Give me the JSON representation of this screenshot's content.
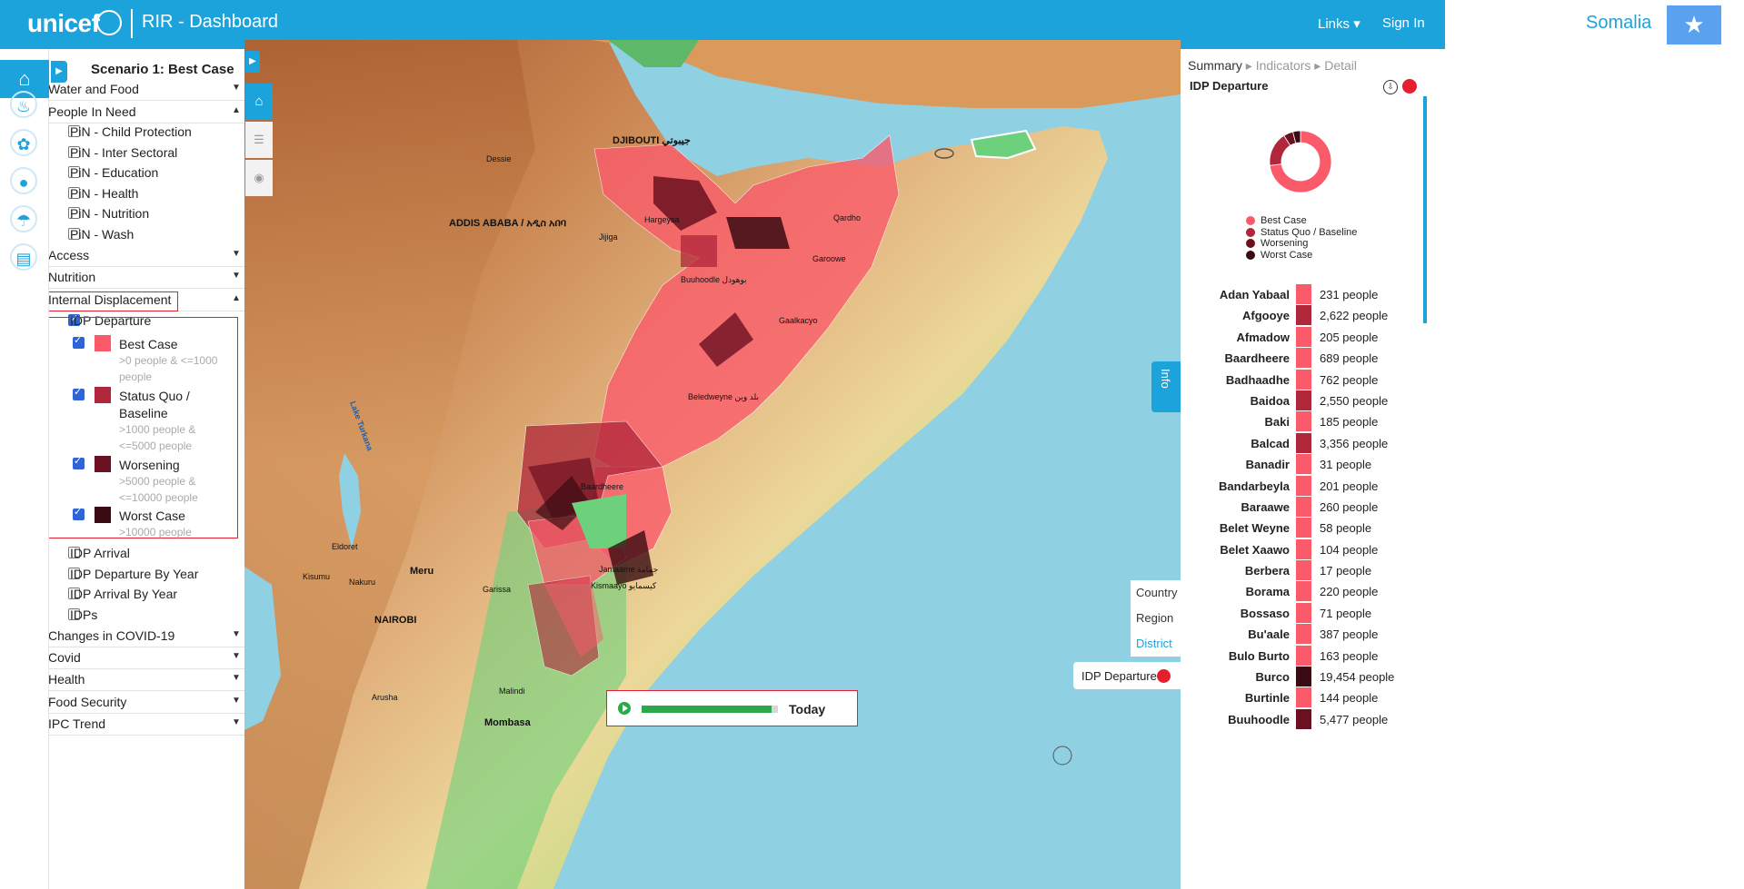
{
  "header": {
    "brand": "unicef",
    "app_title": "RIR - Dashboard",
    "links_label": "Links",
    "sign_in_label": "Sign In",
    "country": "Somalia",
    "brand_color": "#1ca3dc"
  },
  "panel": {
    "scenario": "Scenario 1: Best Case",
    "rows": [
      {
        "label": "Water and Food",
        "caret": "down",
        "dot": "#e5c400",
        "dot_inner": true
      },
      {
        "label": "People In Need",
        "caret": "up",
        "dot": "#e5c400"
      },
      {
        "label": "PiN - Child Protection",
        "checkbox": true,
        "dot": "#e5c400"
      },
      {
        "label": "PiN - Inter Sectoral",
        "checkbox": true,
        "dot": "#e5c400"
      },
      {
        "label": "PiN - Education",
        "checkbox": true,
        "dot": "#e5c400"
      },
      {
        "label": "PiN - Health",
        "checkbox": true,
        "dot": "#e4202e"
      },
      {
        "label": "PiN - Nutrition",
        "checkbox": true,
        "dot": "#e4202e"
      },
      {
        "label": "PiN - Wash",
        "checkbox": true,
        "dot": "#e5c400"
      },
      {
        "label": "Access",
        "caret": "down",
        "dot": "#4a8af4"
      },
      {
        "label": "Nutrition",
        "caret": "down",
        "dot": "#dddddd",
        "dot_inner": true
      },
      {
        "label": "Internal Displacement",
        "caret": "up",
        "dot": "#e4202e"
      },
      {
        "label": "IDP Departure",
        "checkbox": true,
        "checked": true,
        "dot": "#e4202e"
      }
    ],
    "idp_legend": [
      {
        "name": "Best Case",
        "range": ">0 people & <=1000 people",
        "color": "#fb5a6a"
      },
      {
        "name": "Status Quo / Baseline",
        "range": ">1000 people & <=5000 people",
        "color": "#b0263a"
      },
      {
        "name": "Worsening",
        "range": ">5000 people & <=10000 people",
        "color": "#6b1020"
      },
      {
        "name": "Worst Case",
        "range": ">10000 people",
        "color": "#3a0b12"
      }
    ],
    "rows_after": [
      {
        "label": "IDP Arrival",
        "checkbox": true,
        "dot": "#e4202e"
      },
      {
        "label": "IDP Departure By Year",
        "checkbox": true,
        "dot": "#e4202e"
      },
      {
        "label": "IDP Arrival By Year",
        "checkbox": true,
        "dot": "#e4202e"
      },
      {
        "label": "IDPs",
        "checkbox": true,
        "dot": "#e4202e"
      },
      {
        "label": "Changes in COVID-19",
        "caret": "down",
        "dot": "#e4202e"
      },
      {
        "label": "Covid",
        "caret": "down",
        "dot": "#4a8af4"
      },
      {
        "label": "Health",
        "caret": "down",
        "dot": "#dddddd",
        "dot_inner": true
      },
      {
        "label": "Food Security",
        "caret": "down",
        "dot": "#4a8af4"
      },
      {
        "label": "IPC Trend",
        "caret": "down",
        "dot": "#dddddd",
        "dot_inner": true
      }
    ]
  },
  "map": {
    "labels": {
      "djibouti": "DJIBOUTI جيبوتي",
      "addis": "ADDIS ABABA / አዲስ አበባ",
      "nairobi": "NAIROBI",
      "meru": "Meru",
      "garissa": "Garissa",
      "malindi": "Malindi",
      "mombasa": "Mombasa",
      "eldoret": "Eldoret",
      "kisumu": "Kisumu",
      "nakuru": "Nakuru",
      "arusha": "Arusha",
      "hargeysa": "Hargeysa",
      "garoowe": "Garoowe",
      "qardho": "Qardho",
      "gaalkacyo": "Gaalkacyo",
      "beledweyne": "Beledweyne بلد وين",
      "baardheere": "Baardheere",
      "kismaayo": "Kismaayo كيسمايو",
      "jamaame": "Jamaame جمامة",
      "buuhoodle": "Buuhoodle بوهودل",
      "lake_turkana": "Lake Turkana",
      "dessie": "Dessie",
      "jijiga": "Jijiga"
    },
    "admin_levels": [
      "Country",
      "Region",
      "District"
    ],
    "admin_active": "District",
    "legend_label": "IDP Departure",
    "info_label": "Info",
    "timeline_label": "Today",
    "timeline_progress": 0.95
  },
  "right": {
    "breadcrumb": [
      "Summary",
      "Indicators",
      "Detail"
    ],
    "indicator_title": "IDP Departure",
    "donut": [
      {
        "name": "Best Case",
        "color": "#fb5a6a",
        "value": 73
      },
      {
        "name": "Status Quo / Baseline",
        "color": "#b0263a",
        "value": 18
      },
      {
        "name": "Worsening",
        "color": "#6b1020",
        "value": 5
      },
      {
        "name": "Worst Case",
        "color": "#3a0b12",
        "value": 4
      }
    ],
    "districts": [
      {
        "name": "Adan Yabaal",
        "value": "231 people",
        "color": "#fb5a6a"
      },
      {
        "name": "Afgooye",
        "value": "2,622 people",
        "color": "#b0263a"
      },
      {
        "name": "Afmadow",
        "value": "205 people",
        "color": "#fb5a6a"
      },
      {
        "name": "Baardheere",
        "value": "689 people",
        "color": "#fb5a6a"
      },
      {
        "name": "Badhaadhe",
        "value": "762 people",
        "color": "#fb5a6a"
      },
      {
        "name": "Baidoa",
        "value": "2,550 people",
        "color": "#b0263a"
      },
      {
        "name": "Baki",
        "value": "185 people",
        "color": "#fb5a6a"
      },
      {
        "name": "Balcad",
        "value": "3,356 people",
        "color": "#b0263a"
      },
      {
        "name": "Banadir",
        "value": "31 people",
        "color": "#fb5a6a"
      },
      {
        "name": "Bandarbeyla",
        "value": "201 people",
        "color": "#fb5a6a"
      },
      {
        "name": "Baraawe",
        "value": "260 people",
        "color": "#fb5a6a"
      },
      {
        "name": "Belet Weyne",
        "value": "58 people",
        "color": "#fb5a6a"
      },
      {
        "name": "Belet Xaawo",
        "value": "104 people",
        "color": "#fb5a6a"
      },
      {
        "name": "Berbera",
        "value": "17 people",
        "color": "#fb5a6a"
      },
      {
        "name": "Borama",
        "value": "220 people",
        "color": "#fb5a6a"
      },
      {
        "name": "Bossaso",
        "value": "71 people",
        "color": "#fb5a6a"
      },
      {
        "name": "Bu'aale",
        "value": "387 people",
        "color": "#fb5a6a"
      },
      {
        "name": "Bulo Burto",
        "value": "163 people",
        "color": "#fb5a6a"
      },
      {
        "name": "Burco",
        "value": "19,454 people",
        "color": "#3a0b12"
      },
      {
        "name": "Burtinle",
        "value": "144 people",
        "color": "#fb5a6a"
      },
      {
        "name": "Buuhoodle",
        "value": "5,477 people",
        "color": "#6b1020"
      }
    ]
  }
}
